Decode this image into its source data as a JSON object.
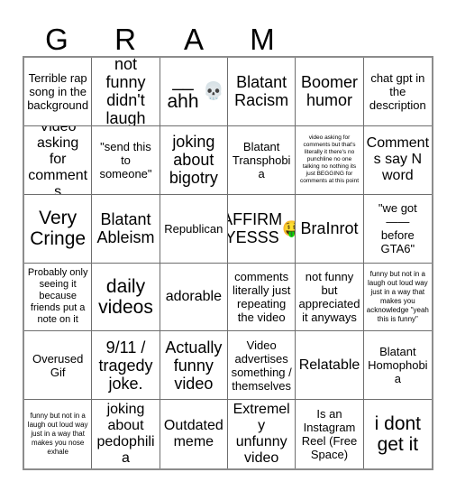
{
  "card": {
    "title": "GRAM",
    "header_letters": [
      "G",
      "R",
      "A",
      "M",
      "",
      ""
    ],
    "columns": 6,
    "rows": 6,
    "border_color": "#8c8c8c",
    "grid_line_color": "#6e6e6e",
    "background_color": "#ffffff",
    "text_color": "#000000"
  },
  "cells": [
    {
      "text": "Terrible rap song in the background",
      "size": "md",
      "emoji": ""
    },
    {
      "text": "not funny didn't laugh",
      "size": "xl",
      "emoji": ""
    },
    {
      "text": "__ ahh",
      "size": "xxl",
      "emoji": "💀"
    },
    {
      "text": "Blatant Racism",
      "size": "xl",
      "emoji": ""
    },
    {
      "text": "Boomer humor",
      "size": "xl",
      "emoji": ""
    },
    {
      "text": "chat gpt in the description",
      "size": "md",
      "emoji": ""
    },
    {
      "text": "Video asking for comments",
      "size": "lg",
      "emoji": ""
    },
    {
      "text": "\"send this to someone\"",
      "size": "md",
      "emoji": ""
    },
    {
      "text": "joking about bigotry",
      "size": "xl",
      "emoji": ""
    },
    {
      "text": "Blatant Transphobia",
      "size": "md",
      "emoji": ""
    },
    {
      "text": "video asking for comments but that's literally it there's no punchline no one talking no nothing its just BEGGING for comments at this point",
      "size": "xxs",
      "emoji": ""
    },
    {
      "text": "Comments say N word",
      "size": "lg",
      "emoji": ""
    },
    {
      "text": "Very Cringe",
      "size": "xxl",
      "emoji": ""
    },
    {
      "text": "Blatant Ableism",
      "size": "xl",
      "emoji": ""
    },
    {
      "text": "Republican",
      "size": "md",
      "emoji": ""
    },
    {
      "text": "AFFIRM YESSS",
      "size": "xl",
      "emoji": "🤑"
    },
    {
      "text": "BraInrot",
      "size": "xl",
      "emoji": ""
    },
    {
      "text": "\"we got\n——\nbefore GTA6\"",
      "size": "md",
      "emoji": ""
    },
    {
      "text": "Probably only seeing it because friends put a note on it",
      "size": "sm",
      "emoji": ""
    },
    {
      "text": "daily videos",
      "size": "xxl",
      "emoji": ""
    },
    {
      "text": "adorable",
      "size": "lg",
      "emoji": ""
    },
    {
      "text": "comments literally just repeating the video",
      "size": "md",
      "emoji": ""
    },
    {
      "text": "not funny but appreciated it anyways",
      "size": "md",
      "emoji": ""
    },
    {
      "text": "funny but not in a laugh out loud way just in a way that makes you acknowledge \"yeah this is funny\"",
      "size": "xs",
      "emoji": ""
    },
    {
      "text": "Overused Gif",
      "size": "md",
      "emoji": ""
    },
    {
      "text": "9/11 / tragedy joke.",
      "size": "xl",
      "emoji": ""
    },
    {
      "text": "Actually funny video",
      "size": "xl",
      "emoji": ""
    },
    {
      "text": "Video advertises something / themselves",
      "size": "md",
      "emoji": ""
    },
    {
      "text": "Relatable",
      "size": "lg",
      "emoji": ""
    },
    {
      "text": "Blatant Homophobia",
      "size": "md",
      "emoji": ""
    },
    {
      "text": "funny but not in a laugh out loud way just in a way that makes you nose exhale",
      "size": "xs",
      "emoji": ""
    },
    {
      "text": "joking about pedophilia",
      "size": "lg",
      "emoji": ""
    },
    {
      "text": "Outdated meme",
      "size": "lg",
      "emoji": ""
    },
    {
      "text": "Extremely unfunny video",
      "size": "lg",
      "emoji": ""
    },
    {
      "text": "Is an Instagram Reel (Free Space)",
      "size": "md",
      "emoji": ""
    },
    {
      "text": "i dont get it",
      "size": "xxl",
      "emoji": ""
    }
  ]
}
